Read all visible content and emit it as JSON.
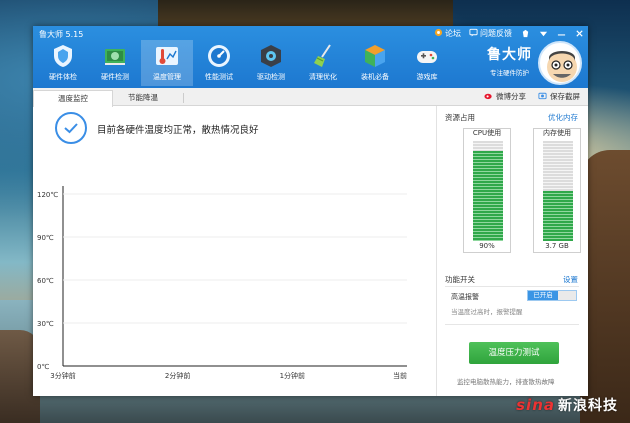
{
  "window": {
    "title": "鲁大师 5.15",
    "controls": {
      "forum": "论坛",
      "feedback": "问题反馈"
    }
  },
  "toolbar": [
    {
      "label": "硬件体检",
      "icon": "shield-icon"
    },
    {
      "label": "硬件检测",
      "icon": "chip-icon"
    },
    {
      "label": "温度管理",
      "icon": "thermometer-icon"
    },
    {
      "label": "性能测试",
      "icon": "gauge-icon"
    },
    {
      "label": "驱动检测",
      "icon": "gear-box-icon"
    },
    {
      "label": "清理优化",
      "icon": "broom-icon"
    },
    {
      "label": "装机必备",
      "icon": "package-icon"
    },
    {
      "label": "游戏库",
      "icon": "gamepad-icon"
    }
  ],
  "brand": {
    "name": "鲁大师",
    "slogan": "专注硬件防护"
  },
  "tabs": [
    {
      "label": "温度监控",
      "active": true
    },
    {
      "label": "节能降温",
      "active": false
    }
  ],
  "tab_actions": {
    "share": "微博分享",
    "screenshot": "保存截屏"
  },
  "status": {
    "message": "目前各硬件温度均正常，散热情况良好"
  },
  "chart_data": {
    "type": "line",
    "title": "",
    "ylabel": "",
    "y_ticks": [
      "120℃",
      "90℃",
      "60℃",
      "30℃",
      "0℃"
    ],
    "ylim": [
      0,
      120
    ],
    "x_ticks": [
      "3分钟前",
      "2分钟前",
      "1分钟前",
      "当前"
    ],
    "grid": true,
    "series": []
  },
  "resources": {
    "title": "资源占用",
    "optimize_link": "优化内存",
    "cpu": {
      "label": "CPU使用",
      "value": "90%",
      "fill": 0.9
    },
    "memory": {
      "label": "内存使用",
      "value": "3.7 GB",
      "fill": 0.5
    }
  },
  "functions": {
    "title": "功能开关",
    "settings_link": "设置",
    "alarm": {
      "label": "高温报警",
      "toggle": "已开启",
      "desc": "当温度过高时，报警提醒"
    },
    "stress_button": "温度压力测试",
    "footer": "监控电脑散热能力，排查散热故障"
  },
  "desktop": {
    "watermark_logo": "sina",
    "watermark_text": "新浪科技"
  },
  "colors": {
    "header": "#1d78d0",
    "accent": "#3a8ee6",
    "meter": "#2fa84a",
    "button": "#2fa43c"
  }
}
